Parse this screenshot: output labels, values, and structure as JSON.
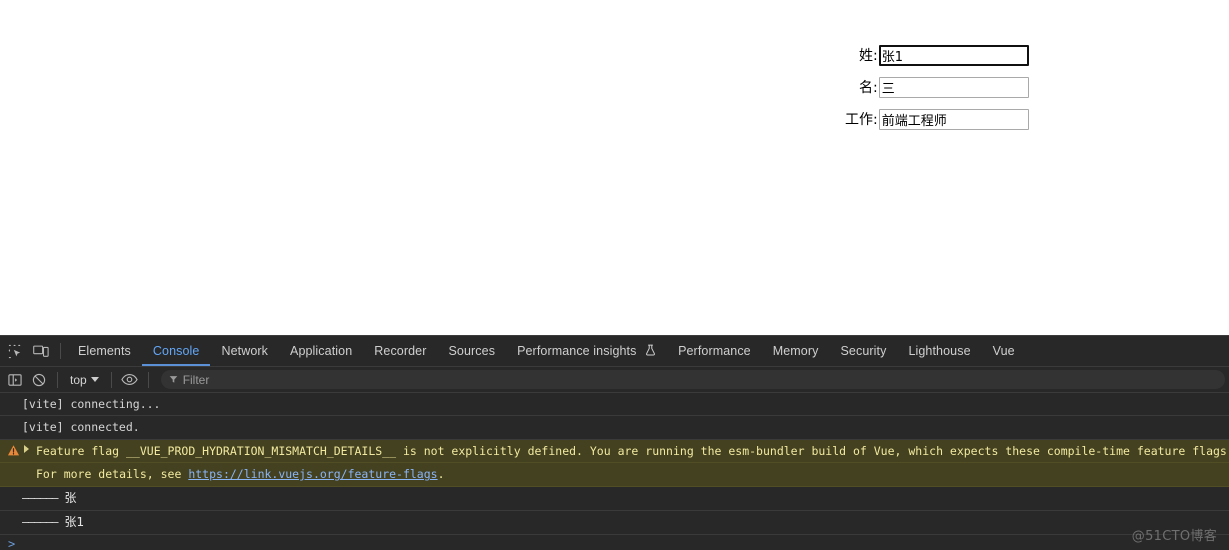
{
  "page": {
    "form": {
      "fields": [
        {
          "label": "姓:",
          "value": "张1",
          "focused": true
        },
        {
          "label": "名:",
          "value": "三",
          "focused": false
        },
        {
          "label": "工作:",
          "value": "前端工程师",
          "focused": false
        }
      ]
    }
  },
  "devtools": {
    "icons": {
      "inspect": "inspect-element-icon",
      "device": "device-toolbar-icon",
      "sidebar": "console-sidebar-icon",
      "clear": "clear-console-icon",
      "eye": "eye-icon",
      "filter": "filter-funnel-icon",
      "flask": "experiment-flask-icon",
      "warning": "warning-triangle-icon"
    },
    "tabs": [
      {
        "label": "Elements",
        "active": false
      },
      {
        "label": "Console",
        "active": true
      },
      {
        "label": "Network",
        "active": false
      },
      {
        "label": "Application",
        "active": false
      },
      {
        "label": "Recorder",
        "active": false
      },
      {
        "label": "Sources",
        "active": false
      },
      {
        "label": "Performance insights",
        "active": false,
        "flask": true
      },
      {
        "label": "Performance",
        "active": false
      },
      {
        "label": "Memory",
        "active": false
      },
      {
        "label": "Security",
        "active": false
      },
      {
        "label": "Lighthouse",
        "active": false
      },
      {
        "label": "Vue",
        "active": false
      }
    ],
    "subbar": {
      "context": "top",
      "filter_placeholder": "Filter"
    },
    "console": {
      "rows": [
        {
          "type": "log",
          "text": "[vite] connecting..."
        },
        {
          "type": "log",
          "text": "[vite] connected."
        },
        {
          "type": "warn",
          "expandable": true,
          "text": "Feature flag __VUE_PROD_HYDRATION_MISMATCH_DETAILS__ is not explicitly defined. You are running the esm-bundler build of Vue, which expects these compile-time feature flags to be globally injected vi"
        },
        {
          "type": "warn-cont",
          "prefix": "For more details, see ",
          "link": "https://link.vuejs.org/feature-flags",
          "suffix": "."
        },
        {
          "type": "dashed",
          "dashes": "——————",
          "value": "张"
        },
        {
          "type": "dashed",
          "dashes": "——————",
          "value": "张1"
        }
      ],
      "prompt": ">"
    },
    "colors": {
      "accent": "#63a7f7",
      "warn_bg": "#43411f",
      "warn_text": "#f2e9a0",
      "link": "#8ab4f8",
      "panel_bg": "#282828"
    }
  },
  "watermark": "@51CTO博客"
}
